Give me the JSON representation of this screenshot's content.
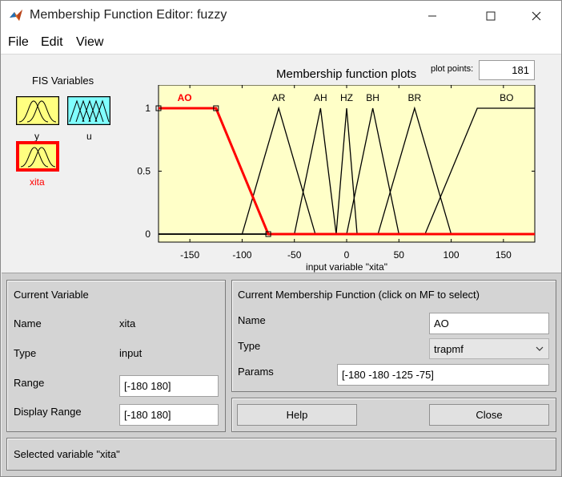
{
  "window": {
    "title": "Membership Function Editor: fuzzy"
  },
  "menu": {
    "items": [
      "File",
      "Edit",
      "View"
    ]
  },
  "fis": {
    "title": "FIS Variables",
    "variables": [
      {
        "name": "y",
        "type": "input",
        "color": "#ffff80"
      },
      {
        "name": "u",
        "type": "output",
        "color": "#80ffff"
      },
      {
        "name": "xita",
        "type": "input",
        "color": "#ffff80",
        "selected": true
      }
    ]
  },
  "plot": {
    "title": "Membership function plots",
    "plot_points_label": "plot points:",
    "plot_points": "181",
    "xlabel": "input variable \"xita\"",
    "x_ticks": [
      "-150",
      "-100",
      "-50",
      "0",
      "50",
      "100",
      "150"
    ],
    "y_ticks": [
      "0",
      "0.5",
      "1"
    ],
    "background": "#ffffc8",
    "selected_color": "#ff0000"
  },
  "chart_data": {
    "type": "line",
    "xlim": [
      -180,
      180
    ],
    "ylim": [
      0,
      1
    ],
    "xlabel": "input variable \"xita\"",
    "title": "Membership function plots",
    "series": [
      {
        "name": "AO",
        "mf": "trapmf",
        "points": [
          [
            -180,
            1
          ],
          [
            -180,
            1
          ],
          [
            -125,
            1
          ],
          [
            -75,
            0
          ]
        ],
        "selected": true
      },
      {
        "name": "AR",
        "mf": "trimf",
        "points": [
          [
            -100,
            0
          ],
          [
            -65,
            1
          ],
          [
            -30,
            0
          ]
        ]
      },
      {
        "name": "AH",
        "mf": "trimf",
        "points": [
          [
            -50,
            0
          ],
          [
            -25,
            1
          ],
          [
            -10,
            0
          ]
        ]
      },
      {
        "name": "HZ",
        "mf": "trimf",
        "points": [
          [
            -10,
            0
          ],
          [
            0,
            1
          ],
          [
            10,
            0
          ]
        ]
      },
      {
        "name": "BH",
        "mf": "trimf",
        "points": [
          [
            0,
            0
          ],
          [
            25,
            1
          ],
          [
            50,
            0
          ]
        ]
      },
      {
        "name": "BR",
        "mf": "trimf",
        "points": [
          [
            30,
            0
          ],
          [
            65,
            1
          ],
          [
            100,
            0
          ]
        ]
      },
      {
        "name": "BO",
        "mf": "trapmf",
        "points": [
          [
            75,
            0
          ],
          [
            125,
            1
          ],
          [
            180,
            1
          ],
          [
            180,
            1
          ]
        ]
      }
    ]
  },
  "current_variable": {
    "title": "Current Variable",
    "name_label": "Name",
    "name_value": "xita",
    "type_label": "Type",
    "type_value": "input",
    "range_label": "Range",
    "range_value": "[-180 180]",
    "display_range_label": "Display Range",
    "display_range_value": "[-180 180]"
  },
  "current_mf": {
    "title": "Current Membership Function (click on MF to select)",
    "name_label": "Name",
    "name_value": "AO",
    "type_label": "Type",
    "type_value": "trapmf",
    "params_label": "Params",
    "params_value": "[-180 -180 -125 -75]"
  },
  "buttons": {
    "help": "Help",
    "close": "Close"
  },
  "status": {
    "text": "Selected variable \"xita\""
  }
}
